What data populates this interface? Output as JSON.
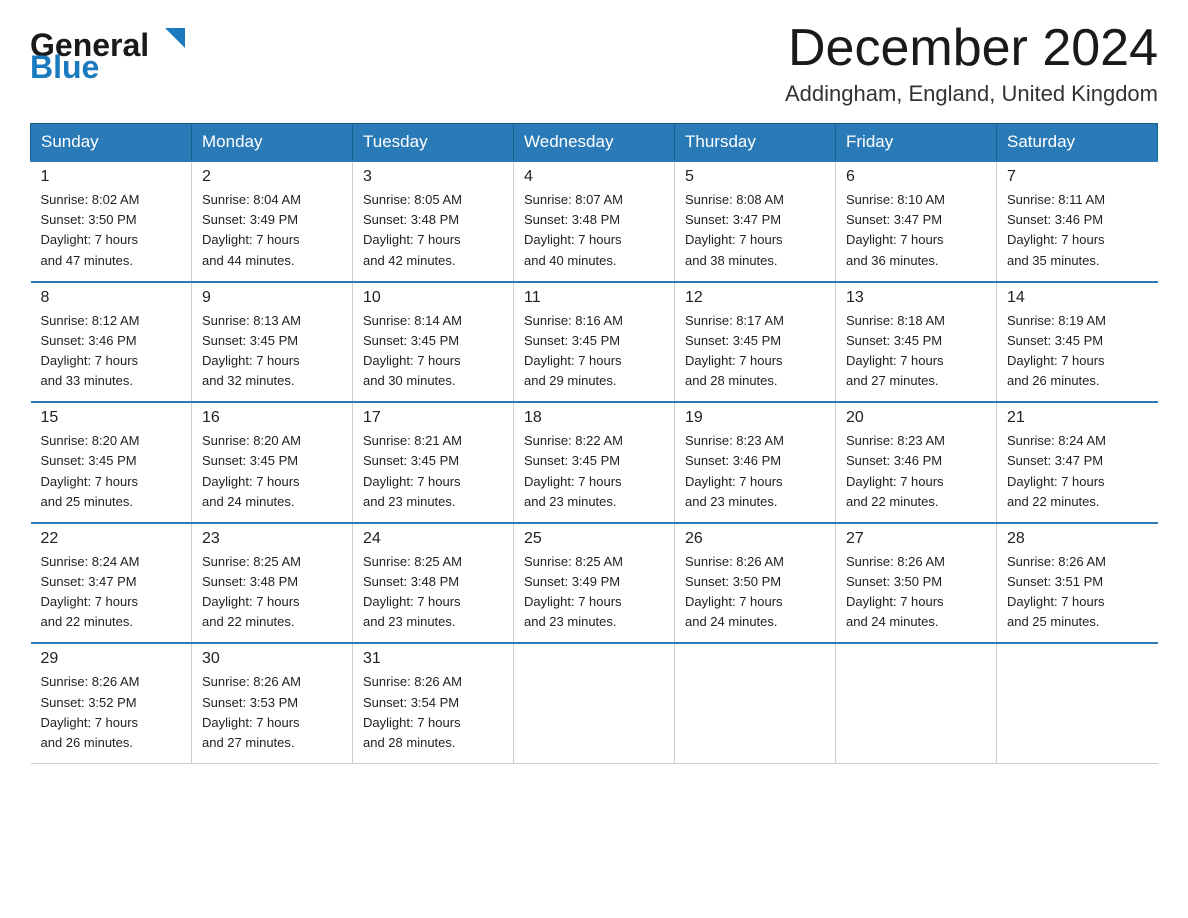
{
  "header": {
    "logo_general": "General",
    "logo_blue": "Blue",
    "month_title": "December 2024",
    "location": "Addingham, England, United Kingdom"
  },
  "weekdays": [
    "Sunday",
    "Monday",
    "Tuesday",
    "Wednesday",
    "Thursday",
    "Friday",
    "Saturday"
  ],
  "weeks": [
    [
      {
        "day": "1",
        "sunrise": "8:02 AM",
        "sunset": "3:50 PM",
        "daylight": "7 hours and 47 minutes."
      },
      {
        "day": "2",
        "sunrise": "8:04 AM",
        "sunset": "3:49 PM",
        "daylight": "7 hours and 44 minutes."
      },
      {
        "day": "3",
        "sunrise": "8:05 AM",
        "sunset": "3:48 PM",
        "daylight": "7 hours and 42 minutes."
      },
      {
        "day": "4",
        "sunrise": "8:07 AM",
        "sunset": "3:48 PM",
        "daylight": "7 hours and 40 minutes."
      },
      {
        "day": "5",
        "sunrise": "8:08 AM",
        "sunset": "3:47 PM",
        "daylight": "7 hours and 38 minutes."
      },
      {
        "day": "6",
        "sunrise": "8:10 AM",
        "sunset": "3:47 PM",
        "daylight": "7 hours and 36 minutes."
      },
      {
        "day": "7",
        "sunrise": "8:11 AM",
        "sunset": "3:46 PM",
        "daylight": "7 hours and 35 minutes."
      }
    ],
    [
      {
        "day": "8",
        "sunrise": "8:12 AM",
        "sunset": "3:46 PM",
        "daylight": "7 hours and 33 minutes."
      },
      {
        "day": "9",
        "sunrise": "8:13 AM",
        "sunset": "3:45 PM",
        "daylight": "7 hours and 32 minutes."
      },
      {
        "day": "10",
        "sunrise": "8:14 AM",
        "sunset": "3:45 PM",
        "daylight": "7 hours and 30 minutes."
      },
      {
        "day": "11",
        "sunrise": "8:16 AM",
        "sunset": "3:45 PM",
        "daylight": "7 hours and 29 minutes."
      },
      {
        "day": "12",
        "sunrise": "8:17 AM",
        "sunset": "3:45 PM",
        "daylight": "7 hours and 28 minutes."
      },
      {
        "day": "13",
        "sunrise": "8:18 AM",
        "sunset": "3:45 PM",
        "daylight": "7 hours and 27 minutes."
      },
      {
        "day": "14",
        "sunrise": "8:19 AM",
        "sunset": "3:45 PM",
        "daylight": "7 hours and 26 minutes."
      }
    ],
    [
      {
        "day": "15",
        "sunrise": "8:20 AM",
        "sunset": "3:45 PM",
        "daylight": "7 hours and 25 minutes."
      },
      {
        "day": "16",
        "sunrise": "8:20 AM",
        "sunset": "3:45 PM",
        "daylight": "7 hours and 24 minutes."
      },
      {
        "day": "17",
        "sunrise": "8:21 AM",
        "sunset": "3:45 PM",
        "daylight": "7 hours and 23 minutes."
      },
      {
        "day": "18",
        "sunrise": "8:22 AM",
        "sunset": "3:45 PM",
        "daylight": "7 hours and 23 minutes."
      },
      {
        "day": "19",
        "sunrise": "8:23 AM",
        "sunset": "3:46 PM",
        "daylight": "7 hours and 23 minutes."
      },
      {
        "day": "20",
        "sunrise": "8:23 AM",
        "sunset": "3:46 PM",
        "daylight": "7 hours and 22 minutes."
      },
      {
        "day": "21",
        "sunrise": "8:24 AM",
        "sunset": "3:47 PM",
        "daylight": "7 hours and 22 minutes."
      }
    ],
    [
      {
        "day": "22",
        "sunrise": "8:24 AM",
        "sunset": "3:47 PM",
        "daylight": "7 hours and 22 minutes."
      },
      {
        "day": "23",
        "sunrise": "8:25 AM",
        "sunset": "3:48 PM",
        "daylight": "7 hours and 22 minutes."
      },
      {
        "day": "24",
        "sunrise": "8:25 AM",
        "sunset": "3:48 PM",
        "daylight": "7 hours and 23 minutes."
      },
      {
        "day": "25",
        "sunrise": "8:25 AM",
        "sunset": "3:49 PM",
        "daylight": "7 hours and 23 minutes."
      },
      {
        "day": "26",
        "sunrise": "8:26 AM",
        "sunset": "3:50 PM",
        "daylight": "7 hours and 24 minutes."
      },
      {
        "day": "27",
        "sunrise": "8:26 AM",
        "sunset": "3:50 PM",
        "daylight": "7 hours and 24 minutes."
      },
      {
        "day": "28",
        "sunrise": "8:26 AM",
        "sunset": "3:51 PM",
        "daylight": "7 hours and 25 minutes."
      }
    ],
    [
      {
        "day": "29",
        "sunrise": "8:26 AM",
        "sunset": "3:52 PM",
        "daylight": "7 hours and 26 minutes."
      },
      {
        "day": "30",
        "sunrise": "8:26 AM",
        "sunset": "3:53 PM",
        "daylight": "7 hours and 27 minutes."
      },
      {
        "day": "31",
        "sunrise": "8:26 AM",
        "sunset": "3:54 PM",
        "daylight": "7 hours and 28 minutes."
      },
      null,
      null,
      null,
      null
    ]
  ],
  "labels": {
    "sunrise_prefix": "Sunrise: ",
    "sunset_prefix": "Sunset: ",
    "daylight_prefix": "Daylight: "
  }
}
